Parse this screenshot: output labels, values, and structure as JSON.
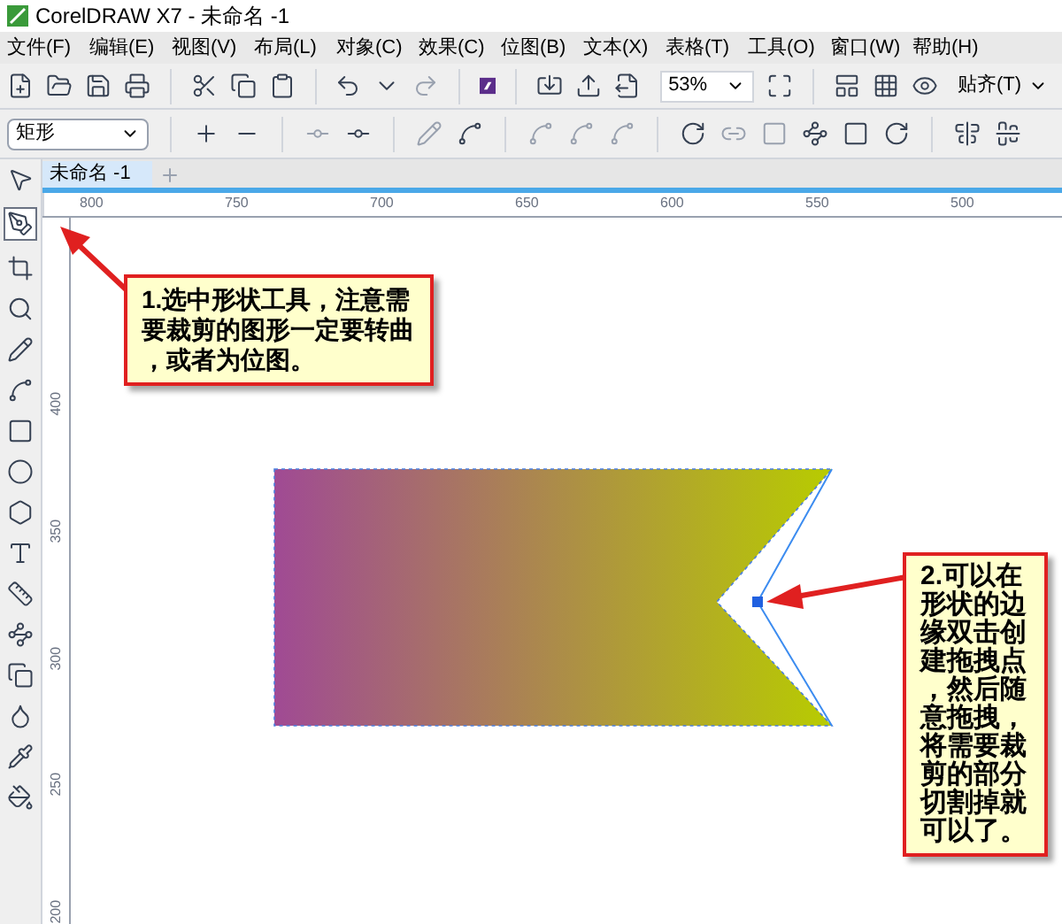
{
  "window": {
    "title": "CorelDRAW X7 - 未命名 -1"
  },
  "menu": [
    "文件(F)",
    "编辑(E)",
    "视图(V)",
    "布局(L)",
    "对象(C)",
    "效果(C)",
    "位图(B)",
    "文本(X)",
    "表格(T)",
    "工具(O)",
    "窗口(W)",
    "帮助(H)"
  ],
  "toolbar": {
    "zoom": "53%",
    "snap": "贴齐(T)"
  },
  "property_bar": {
    "shape_type": "矩形"
  },
  "document_tab": {
    "label": "未命名 -1"
  },
  "ruler": {
    "horizontal": [
      "800",
      "750",
      "700",
      "650",
      "600",
      "550",
      "500"
    ],
    "vertical": [
      "400",
      "350",
      "300",
      "250",
      "200"
    ]
  },
  "callouts": [
    {
      "text": "1.选中形状工具，注意需要裁剪的图形一定要转曲，或者为位图。"
    },
    {
      "text": "2.可以在形状的边缘双击创建拖拽点，然后随意拖拽，将需要裁剪的部分切割掉就可以了。"
    }
  ]
}
